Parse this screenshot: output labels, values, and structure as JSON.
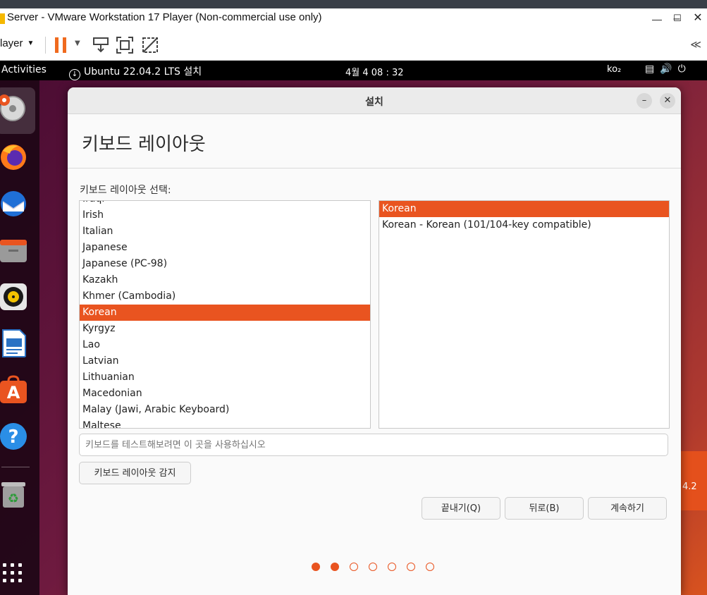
{
  "vmware": {
    "title": "Server - VMware Workstation 17 Player (Non-commercial use only)",
    "player_menu": "layer"
  },
  "ubuntu_topbar": {
    "activities": "Activities",
    "installer_indicator": "Ubuntu 22.04.2 LTS 설치",
    "clock": "4월 4  08 : 32",
    "input_method": "ko₂"
  },
  "desktop": {
    "peek_text": "4.2"
  },
  "installer": {
    "window_title": "설치",
    "page_title": "키보드 레이아웃",
    "section_label": "키보드 레이아웃 선택:",
    "layouts": [
      "Iraqi",
      "Irish",
      "Italian",
      "Japanese",
      "Japanese (PC-98)",
      "Kazakh",
      "Khmer (Cambodia)",
      "Korean",
      "Kyrgyz",
      "Lao",
      "Latvian",
      "Lithuanian",
      "Macedonian",
      "Malay (Jawi, Arabic Keyboard)",
      "Maltese"
    ],
    "selected_layout": "Korean",
    "variants": [
      "Korean",
      "Korean - Korean (101/104-key compatible)"
    ],
    "selected_variant": "Korean",
    "test_placeholder": "키보드를 테스트해보려면 이 곳을 사용하십시오",
    "detect_button": "키보드 레이아웃 감지",
    "quit_button": "끝내기(Q)",
    "back_button": "뒤로(B)",
    "continue_button": "계속하기",
    "progress": {
      "total_steps": 7,
      "completed_steps": 2
    }
  },
  "colors": {
    "accent": "#e95420",
    "vmware_pause": "#f06a1e"
  }
}
